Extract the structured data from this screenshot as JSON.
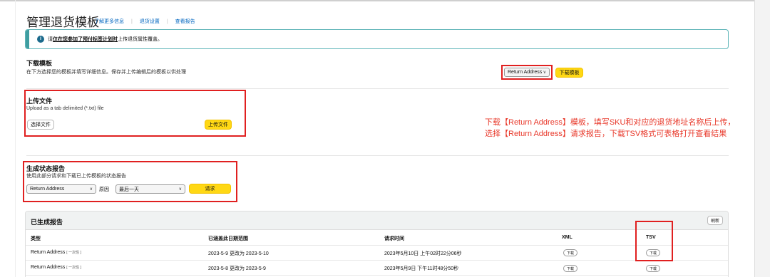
{
  "header": {
    "title": "管理退货模板",
    "links": [
      "了解更多信息",
      "退货设置",
      "查看报告"
    ]
  },
  "banner": {
    "prefix": "请",
    "link": "仅在您参加了预付标签计划时",
    "suffix": "上传退货属性覆盖。"
  },
  "download_template": {
    "title": "下载模板",
    "subtitle": "在下方选择您的模板并填写详细信息。保存并上传编辑后的模板以供处理",
    "select_value": "Return Address",
    "button": "下载模板"
  },
  "upload_file": {
    "title": "上传文件",
    "subtitle": "Upload as a tab delimited (*.txt) file",
    "choose_button": "选择文件",
    "upload_button": "上传文件"
  },
  "annotation": {
    "line1": "下载【Return Address】模板，填写SKU和对应的退货地址名称后上传，",
    "line2": "选择【Return Address】请求报告，下载TSV格式可表格打开查看结果"
  },
  "status_report": {
    "title": "生成状态报告",
    "subtitle": "使用此部分请求和下载已上传模板的状态报告",
    "type_select": "Return Address",
    "reason_label": "原因",
    "range_select": "最后一天",
    "request_button": "请求"
  },
  "reports": {
    "title": "已生成报告",
    "refresh": "刷新",
    "columns": [
      "类型",
      "已涵盖此日期范围",
      "请求时间",
      "XML",
      "TSV"
    ],
    "rows": [
      {
        "type": "Return Address",
        "tag": "[ 一次性 ]",
        "range": "2023-5-9   更改为   2023-5-10",
        "requested": "2023年5月10日 上午02时22分06秒",
        "xml": "下载",
        "tsv": "下载"
      },
      {
        "type": "Return Address",
        "tag": "[ 一次性 ]",
        "range": "2023-5-8   更改为   2023-5-9",
        "requested": "2023年5月9日 下午11时48分50秒",
        "xml": "下载",
        "tsv": "下载"
      }
    ]
  },
  "colors": {
    "annotation_red": "#e8382a",
    "highlight_box": "#e02020",
    "primary_button": "#ffd814",
    "link_blue": "#0066c0",
    "banner_teal": "#3f9da0"
  }
}
